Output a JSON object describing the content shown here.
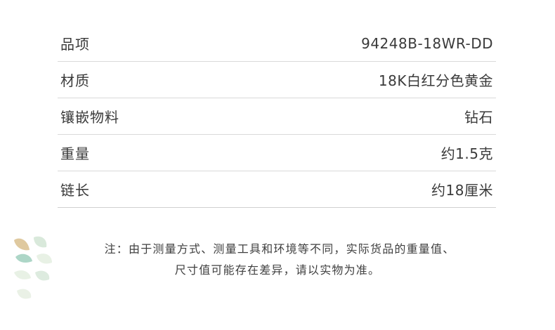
{
  "specs": [
    {
      "label": "品项",
      "value": "94248B-18WR-DD"
    },
    {
      "label": "材质",
      "value": "18K白红分色黄金"
    },
    {
      "label": "镶嵌物料",
      "value": "钻石"
    },
    {
      "label": "重量",
      "value": "约1.5克"
    },
    {
      "label": "链长",
      "value": "约18厘米"
    }
  ],
  "note": {
    "line1": "注：由于测量方式、测量工具和环境等不同，实际货品的重量值、",
    "line2": "尺寸值可能存在差异，请以实物为准。"
  },
  "decor": {
    "icon": "leaf-sprig-icon",
    "colors": [
      "#d9bf8e",
      "#9fcfbd",
      "#cfe3d2",
      "#e6efe2"
    ]
  }
}
